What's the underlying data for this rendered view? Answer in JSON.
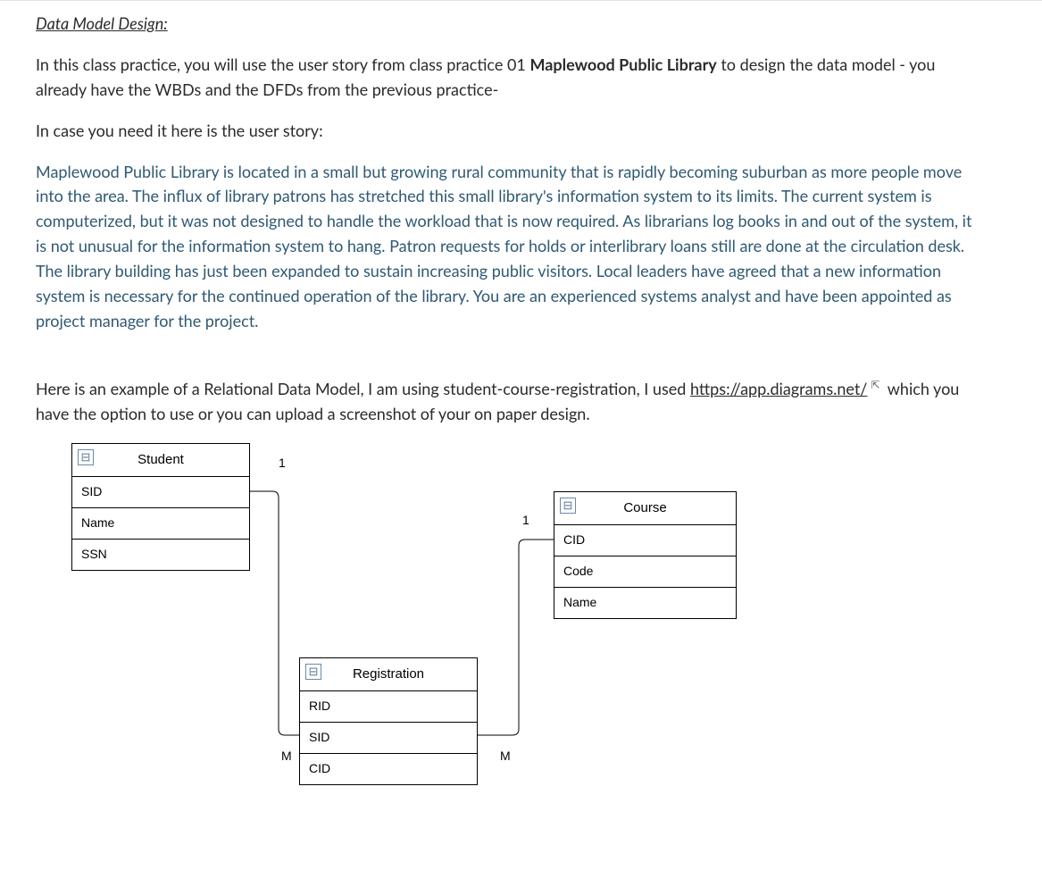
{
  "heading": "Data Model Design:",
  "intro_part1": "In this class practice, you will use the user story from class practice 01 ",
  "intro_bold": "Maplewood Public Library",
  "intro_part2": " to design the data model - you already have the WBDs and the DFDs from the previous practice-",
  "need_line": "In case you need it here is the user story:",
  "story": "Maplewood Public Library is located in a small but growing rural community that is rapidly becoming suburban as more people move into the area. The influx of library patrons has stretched this small library's information system to its limits. The current system is computerized, but it was not designed to handle the workload that is now required. As librarians log books in and out of the system, it is not unusual for the information system to hang. Patron requests for holds or interlibrary loans still are done at the circulation desk. The library building has just been expanded to sustain increasing public visitors. Local leaders have agreed that a new information system is necessary for the continued operation of the library. You are an experienced systems analyst and have been appointed as project manager for the project.",
  "example_part1": "Here is an example of a Relational Data Model, I am using student-course-registration, I used ",
  "example_link": "https://app.diagrams.net/",
  "example_part2": " which you have the option to use or you can upload a screenshot of your on paper design.",
  "collapse_glyph": "⊟",
  "entities": {
    "student": {
      "title": "Student",
      "attrs": [
        "SID",
        "Name",
        "SSN"
      ]
    },
    "course": {
      "title": "Course",
      "attrs": [
        "CID",
        "Code",
        "Name"
      ]
    },
    "registration": {
      "title": "Registration",
      "attrs": [
        "RID",
        "SID",
        "CID"
      ]
    }
  },
  "cardinality": {
    "one_a": "1",
    "one_b": "1",
    "many_a": "M",
    "many_b": "M"
  }
}
